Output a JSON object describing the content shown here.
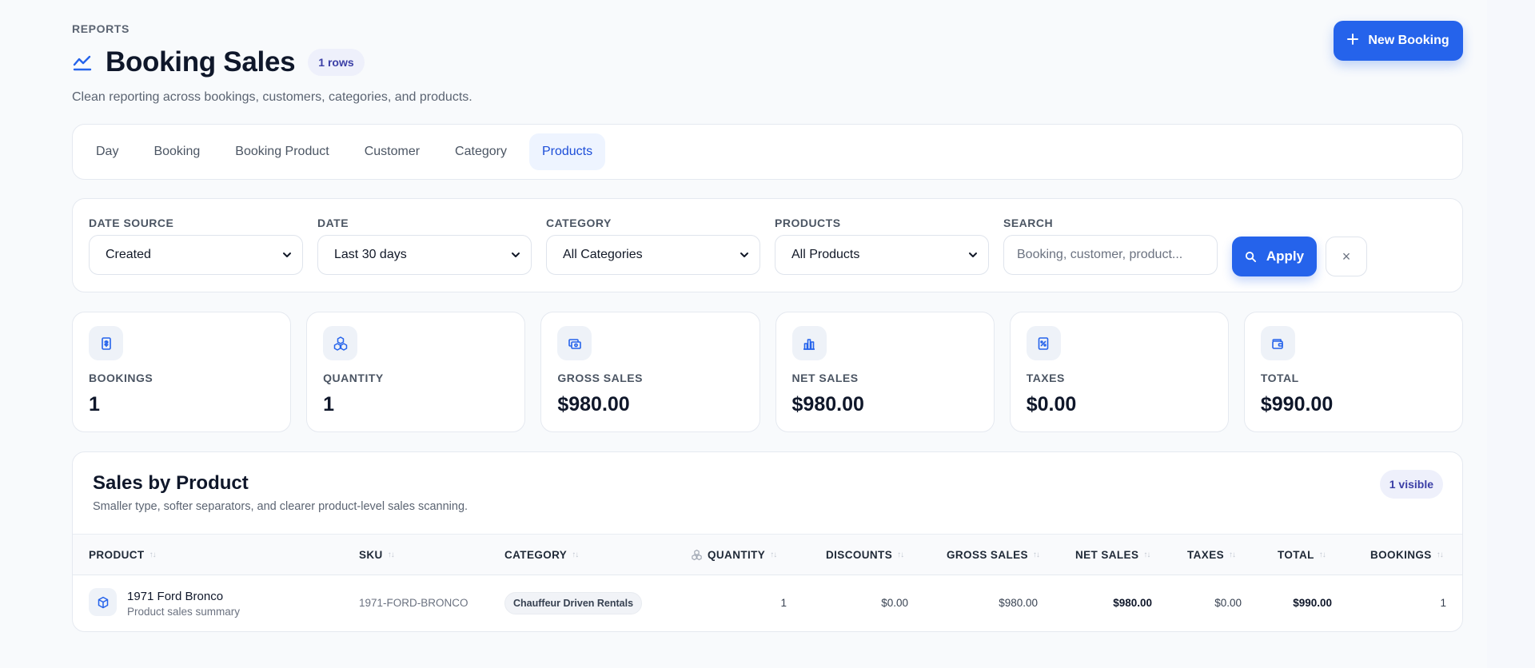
{
  "header": {
    "kicker": "REPORTS",
    "title": "Booking Sales",
    "rows_badge": "1 rows",
    "subtitle": "Clean reporting across bookings, customers, categories, and products.",
    "new_button": "New Booking"
  },
  "tabs": [
    {
      "label": "Day",
      "active": false
    },
    {
      "label": "Booking",
      "active": false
    },
    {
      "label": "Booking Product",
      "active": false
    },
    {
      "label": "Customer",
      "active": false
    },
    {
      "label": "Category",
      "active": false
    },
    {
      "label": "Products",
      "active": true
    }
  ],
  "filters": {
    "date_source": {
      "label": "DATE SOURCE",
      "value": "Created"
    },
    "date": {
      "label": "DATE",
      "value": "Last 30 days"
    },
    "category": {
      "label": "CATEGORY",
      "value": "All Categories"
    },
    "products": {
      "label": "PRODUCTS",
      "value": "All Products"
    },
    "search": {
      "label": "SEARCH",
      "placeholder": "Booking, customer, product..."
    },
    "apply": "Apply",
    "clear": "×"
  },
  "stats": [
    {
      "label": "BOOKINGS",
      "value": "1",
      "icon": "receipt-icon"
    },
    {
      "label": "QUANTITY",
      "value": "1",
      "icon": "boxes-icon"
    },
    {
      "label": "GROSS SALES",
      "value": "$980.00",
      "icon": "cash-icon"
    },
    {
      "label": "NET SALES",
      "value": "$980.00",
      "icon": "bar-chart-icon"
    },
    {
      "label": "TAXES",
      "value": "$0.00",
      "icon": "tax-icon"
    },
    {
      "label": "TOTAL",
      "value": "$990.00",
      "icon": "wallet-icon"
    }
  ],
  "table": {
    "title": "Sales by Product",
    "subtitle": "Smaller type, softer separators, and clearer product-level sales scanning.",
    "visible_badge": "1 visible",
    "columns": [
      "PRODUCT",
      "SKU",
      "CATEGORY",
      "QUANTITY",
      "DISCOUNTS",
      "GROSS SALES",
      "NET SALES",
      "TAXES",
      "TOTAL",
      "BOOKINGS"
    ],
    "rows": [
      {
        "product": "1971 Ford Bronco",
        "product_sub": "Product sales summary",
        "sku": "1971-FORD-BRONCO",
        "category": "Chauffeur Driven Rentals",
        "quantity": "1",
        "discounts": "$0.00",
        "gross_sales": "$980.00",
        "net_sales": "$980.00",
        "taxes": "$0.00",
        "total": "$990.00",
        "bookings": "1"
      }
    ]
  },
  "colors": {
    "accent": "#2563eb",
    "badge_bg": "#eef0fb",
    "badge_text": "#3b3fa6",
    "page_bg": "#f8fafc"
  }
}
